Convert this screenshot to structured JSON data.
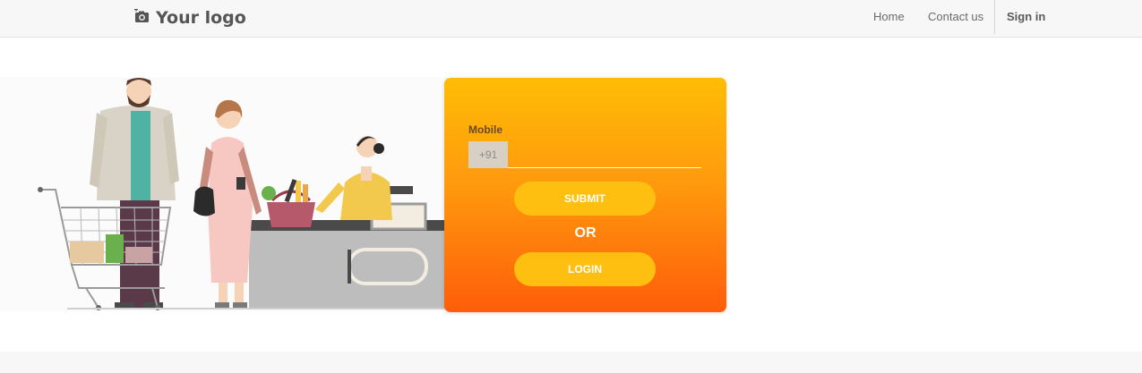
{
  "navbar": {
    "logo_text": "Your logo",
    "logo_icon": "camera-plus-icon",
    "links": [
      {
        "label": "Home"
      },
      {
        "label": "Contact us"
      },
      {
        "label": "Sign in"
      }
    ]
  },
  "illustration": {
    "description_icon": "shopping-checkout-illustration"
  },
  "form": {
    "mobile_label": "Mobile",
    "country_code": "+91",
    "mobile_value": "",
    "submit_label": "SUBMIT",
    "or_label": "OR",
    "login_label": "LOGIN"
  },
  "colors": {
    "card_top": "#ffbc06",
    "card_bottom": "#ff5d0a",
    "button": "#ffbf10"
  }
}
